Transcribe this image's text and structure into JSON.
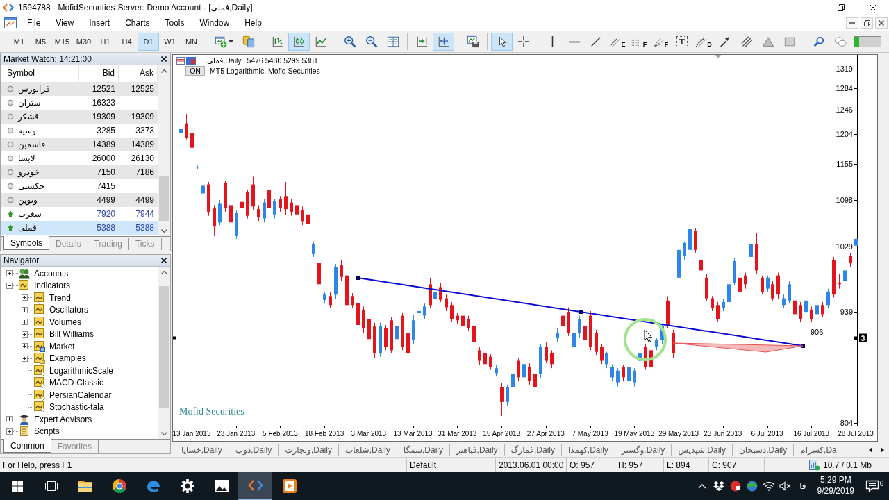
{
  "window": {
    "title": "1594788 - MofidSecurities-Server: Demo Account - [فملی,Daily]"
  },
  "menu": [
    "File",
    "View",
    "Insert",
    "Charts",
    "Tools",
    "Window",
    "Help"
  ],
  "toolbar": {
    "timeframes": [
      {
        "label": "M1",
        "selected": false
      },
      {
        "label": "M5",
        "selected": false
      },
      {
        "label": "M15",
        "selected": false
      },
      {
        "label": "M30",
        "selected": false
      },
      {
        "label": "H1",
        "selected": false
      },
      {
        "label": "H4",
        "selected": false
      },
      {
        "label": "D1",
        "selected": true
      },
      {
        "label": "W1",
        "selected": false
      },
      {
        "label": "MN",
        "selected": false
      }
    ],
    "groups": [
      [
        {
          "kind": "new-chart",
          "selected": false,
          "dropdown": true
        },
        {
          "kind": "profiles",
          "selected": false
        }
      ],
      [
        {
          "kind": "bars",
          "selected": false
        },
        {
          "kind": "candles",
          "selected": true
        },
        {
          "kind": "line",
          "selected": false
        }
      ],
      [
        {
          "kind": "zoom-in",
          "selected": false
        },
        {
          "kind": "zoom-out",
          "selected": false
        },
        {
          "kind": "tile",
          "selected": false
        }
      ],
      [
        {
          "kind": "shift",
          "selected": false
        },
        {
          "kind": "autoscroll",
          "selected": true
        }
      ],
      [
        {
          "kind": "templates",
          "selected": false
        }
      ],
      [
        {
          "kind": "cursor",
          "selected": true
        },
        {
          "kind": "crosshair",
          "selected": false
        }
      ],
      [
        {
          "kind": "vline",
          "selected": false
        },
        {
          "kind": "hline",
          "selected": false
        },
        {
          "kind": "trendline",
          "selected": false
        },
        {
          "kind": "fibo-stairs",
          "selected": false,
          "letter": "E"
        },
        {
          "kind": "fibo-levels",
          "selected": false,
          "letter": "F"
        },
        {
          "kind": "fibo-fan",
          "selected": false,
          "letter": "F"
        },
        {
          "kind": "text",
          "selected": false,
          "letter": "T"
        },
        {
          "kind": "pitchfork",
          "selected": false,
          "letter": "D"
        },
        {
          "kind": "arrow",
          "selected": false
        },
        {
          "kind": "channel",
          "selected": false
        },
        {
          "kind": "triangle",
          "selected": false
        },
        {
          "kind": "rectangle",
          "selected": false
        }
      ],
      [
        {
          "kind": "search",
          "selected": false
        },
        {
          "kind": "chat",
          "selected": false
        }
      ]
    ]
  },
  "market_watch": {
    "title": "Market Watch: 14:21:00",
    "columns": [
      "Symbol",
      "Bid",
      "Ask"
    ],
    "rows": [
      {
        "symbol": "فرابورس",
        "bid": "12521",
        "ask": "12525",
        "kind": "idle",
        "selected": false
      },
      {
        "symbol": "ستران",
        "bid": "16323",
        "kind": "idle",
        "selected": false
      },
      {
        "symbol": "قشکر",
        "bid": "19309",
        "ask": "19309",
        "kind": "idle",
        "selected": false
      },
      {
        "symbol": "وسپه",
        "bid": "3285",
        "ask": "3373",
        "kind": "idle",
        "selected": false
      },
      {
        "symbol": "فاسمین",
        "bid": "14389",
        "ask": "14389",
        "kind": "idle",
        "selected": false
      },
      {
        "symbol": "لابسا",
        "bid": "26000",
        "ask": "26130",
        "kind": "idle",
        "selected": false
      },
      {
        "symbol": "خودرو",
        "bid": "7150",
        "ask": "7186",
        "kind": "idle",
        "selected": false
      },
      {
        "symbol": "حکشتی",
        "bid": "7415",
        "kind": "idle",
        "selected": false
      },
      {
        "symbol": "ونوین",
        "bid": "4499",
        "ask": "4499",
        "kind": "idle",
        "selected": false
      },
      {
        "symbol": "سغرب",
        "bid": "7920",
        "ask": "7944",
        "kind": "up",
        "selected": false
      },
      {
        "symbol": "فملی",
        "bid": "5388",
        "ask": "5388",
        "kind": "up",
        "selected": true
      }
    ],
    "tabs": [
      {
        "label": "Symbols",
        "selected": true
      },
      {
        "label": "Details",
        "selected": false
      },
      {
        "label": "Trading",
        "selected": false
      },
      {
        "label": "Ticks",
        "selected": false
      }
    ]
  },
  "navigator": {
    "title": "Navigator",
    "tree": [
      {
        "label": "Accounts",
        "kind": "accounts",
        "expanded": false
      },
      {
        "label": "Indicators",
        "kind": "folder",
        "expanded": true,
        "children": [
          {
            "label": "Trend",
            "kind": "folder",
            "expanded": false
          },
          {
            "label": "Oscillators",
            "kind": "folder",
            "expanded": false
          },
          {
            "label": "Volumes",
            "kind": "folder",
            "expanded": false
          },
          {
            "label": "Bill Williams",
            "kind": "folder",
            "expanded": false
          },
          {
            "label": "Market",
            "kind": "market",
            "expanded": false
          },
          {
            "label": "Examples",
            "kind": "examples",
            "expanded": false
          },
          {
            "label": "LogarithmicScale",
            "kind": "indicator"
          },
          {
            "label": "MACD-Classic",
            "kind": "indicator"
          },
          {
            "label": "PersianCalendar",
            "kind": "indicator"
          },
          {
            "label": "Stochastic-tala",
            "kind": "indicator"
          }
        ]
      },
      {
        "label": "Expert Advisors",
        "kind": "experts",
        "expanded": false
      },
      {
        "label": "Scripts",
        "kind": "scripts",
        "expanded": false
      }
    ],
    "tabs": [
      {
        "label": "Common",
        "selected": true
      },
      {
        "label": "Favorites",
        "selected": false
      }
    ]
  },
  "chart": {
    "symbol_label": "فملی,Daily",
    "ohlc_text": "5476 5480 5299 5381",
    "indicator_button": "ON",
    "indicator_label": "MT5 Logarithmic, Mofid Securities",
    "caption": "Mofid Securities",
    "price_tag": "3",
    "chart_data": [
      {
        "type": "candlestick",
        "log": true,
        "ylim": [
          801,
          1342
        ],
        "yticks": [
          804,
          939,
          1029,
          1098,
          1155,
          1204,
          1246,
          1284,
          1319
        ],
        "categories": [
          null,
          null,
          "13 Jan 2013",
          null,
          null,
          null,
          null,
          null,
          null,
          null,
          "23 Jan 2013",
          null,
          null,
          null,
          null,
          null,
          null,
          null,
          "5 Feb 2013",
          null,
          null,
          null,
          null,
          null,
          null,
          null,
          "18 Feb 2013",
          null,
          null,
          null,
          null,
          null,
          null,
          null,
          "3 Mar 2013",
          null,
          null,
          null,
          null,
          null,
          null,
          null,
          "13 Mar 2013",
          null,
          null,
          null,
          null,
          null,
          null,
          null,
          "31 Mar 2013",
          null,
          null,
          null,
          null,
          null,
          null,
          null,
          "15 Apr 2013",
          null,
          null,
          null,
          null,
          null,
          null,
          null,
          "27 Apr 2013",
          null,
          null,
          null,
          null,
          null,
          null,
          null,
          "7 May 2013",
          null,
          null,
          null,
          null,
          null,
          null,
          null,
          "19 May 2013",
          null,
          null,
          null,
          null,
          null,
          null,
          null,
          "29 May 2013",
          null,
          null,
          null,
          null,
          null,
          null,
          null,
          "23 Jun 2013",
          null,
          null,
          null,
          null,
          null,
          null,
          null,
          "6 Jul 2013",
          null,
          null,
          null,
          null,
          null,
          null,
          null,
          "16 Jul 2013",
          null,
          null,
          null,
          null,
          null,
          null,
          null,
          "28 Jul 2013"
        ],
        "ohlc": [
          [
            1206,
            1240,
            1200,
            1212
          ],
          [
            1222,
            1238,
            1195,
            1197
          ],
          [
            1205,
            1211,
            1170,
            1181
          ],
          [
            1149,
            1152,
            1146,
            1150
          ],
          [
            1108,
            1124,
            1104,
            1120
          ],
          [
            1122,
            1126,
            1074,
            1080
          ],
          [
            1085,
            1090,
            1044,
            1058
          ],
          [
            1064,
            1098,
            1060,
            1092
          ],
          [
            1125,
            1128,
            1080,
            1085
          ],
          [
            1090,
            1095,
            1060,
            1064
          ],
          [
            1044,
            1082,
            1040,
            1078
          ],
          [
            1095,
            1100,
            1080,
            1086
          ],
          [
            1110,
            1114,
            1070,
            1074
          ],
          [
            1122,
            1134,
            1082,
            1088
          ],
          [
            1084,
            1090,
            1066,
            1072
          ],
          [
            1070,
            1100,
            1064,
            1094
          ],
          [
            1114,
            1130,
            1080,
            1086
          ],
          [
            1076,
            1100,
            1070,
            1096
          ],
          [
            1100,
            1104,
            1080,
            1086
          ],
          [
            1104,
            1126,
            1076,
            1084
          ],
          [
            1094,
            1100,
            1074,
            1080
          ],
          [
            1090,
            1096,
            1070,
            1076
          ],
          [
            1082,
            1088,
            1060,
            1066
          ],
          [
            1076,
            1082,
            1056,
            1062
          ],
          [
            1018,
            1036,
            1014,
            1032
          ],
          [
            1006,
            1012,
            970,
            976
          ],
          [
            955,
            966,
            950,
            962
          ],
          [
            960,
            965,
            944,
            948
          ],
          [
            962,
            1004,
            956,
            1000
          ],
          [
            1002,
            1010,
            980,
            986
          ],
          [
            988,
            992,
            944,
            948
          ],
          [
            960,
            964,
            944,
            948
          ],
          [
            951,
            955,
            918,
            922
          ],
          [
            942,
            946,
            912,
            918
          ],
          [
            930,
            936,
            900,
            904
          ],
          [
            920,
            925,
            880,
            886
          ],
          [
            886,
            925,
            882,
            921
          ],
          [
            918,
            922,
            890,
            894
          ],
          [
            928,
            932,
            886,
            890
          ],
          [
            904,
            926,
            900,
            921
          ],
          [
            934,
            938,
            890,
            894
          ],
          [
            912,
            916,
            882,
            886
          ],
          [
            903,
            935,
            898,
            928
          ],
          [
            938,
            942,
            936,
            940
          ],
          [
            934,
            950,
            930,
            946
          ],
          [
            976,
            985,
            944,
            948
          ],
          [
            956,
            970,
            950,
            966
          ],
          [
            972,
            978,
            952,
            955
          ],
          [
            957,
            962,
            940,
            945
          ],
          [
            948,
            952,
            926,
            930
          ],
          [
            934,
            938,
            924,
            928
          ],
          [
            934,
            937,
            918,
            921
          ],
          [
            930,
            934,
            914,
            918
          ],
          [
            921,
            925,
            896,
            900
          ],
          [
            890,
            894,
            872,
            877
          ],
          [
            886,
            888,
            870,
            873
          ],
          [
            882,
            885,
            866,
            869
          ],
          [
            862,
            872,
            858,
            868
          ],
          [
            845,
            850,
            812,
            828
          ],
          [
            828,
            848,
            824,
            845
          ],
          [
            845,
            864,
            840,
            861
          ],
          [
            877,
            880,
            852,
            857
          ],
          [
            857,
            876,
            852,
            873
          ],
          [
            869,
            874,
            848,
            853
          ],
          [
            861,
            864,
            838,
            845
          ],
          [
            861,
            898,
            856,
            894
          ],
          [
            894,
            900,
            874,
            877
          ],
          [
            886,
            890,
            868,
            873
          ],
          [
            905,
            918,
            900,
            912
          ],
          [
            934,
            940,
            918,
            921
          ],
          [
            939,
            945,
            908,
            912
          ],
          [
            894,
            918,
            890,
            912
          ],
          [
            912,
            934,
            906,
            930
          ],
          [
            921,
            926,
            900,
            903
          ],
          [
            934,
            940,
            890,
            894
          ],
          [
            912,
            916,
            884,
            888
          ],
          [
            894,
            898,
            873,
            877
          ],
          [
            873,
            888,
            868,
            886
          ],
          [
            857,
            872,
            852,
            869
          ],
          [
            851,
            868,
            846,
            865
          ],
          [
            869,
            872,
            852,
            857
          ],
          [
            853,
            872,
            848,
            869
          ],
          [
            851,
            868,
            846,
            865
          ],
          [
            877,
            890,
            872,
            886
          ],
          [
            894,
            898,
            866,
            869
          ],
          [
            890,
            893,
            866,
            869
          ],
          [
            894,
            905,
            890,
            903
          ],
          [
            903,
            924,
            898,
            921
          ],
          [
            954,
            960,
            918,
            921
          ],
          [
            912,
            916,
            880,
            886
          ],
          [
            985,
            1028,
            980,
            1024
          ],
          [
            1015,
            1036,
            1010,
            1034
          ],
          [
            1024,
            1060,
            1020,
            1054
          ],
          [
            1052,
            1056,
            1020,
            1024
          ],
          [
            1010,
            1014,
            990,
            995
          ],
          [
            985,
            990,
            954,
            957
          ],
          [
            957,
            960,
            940,
            944
          ],
          [
            948,
            952,
            926,
            930
          ],
          [
            944,
            956,
            940,
            952
          ],
          [
            952,
            980,
            948,
            976
          ],
          [
            978,
            1012,
            974,
            1008
          ],
          [
            985,
            990,
            960,
            966
          ],
          [
            988,
            992,
            970,
            976
          ],
          [
            1014,
            1036,
            1010,
            1032
          ],
          [
            1032,
            1048,
            990,
            995
          ],
          [
            985,
            988,
            962,
            966
          ],
          [
            970,
            988,
            966,
            985
          ],
          [
            976,
            980,
            954,
            957
          ],
          [
            988,
            992,
            956,
            962
          ],
          [
            948,
            962,
            944,
            957
          ],
          [
            954,
            980,
            950,
            976
          ],
          [
            954,
            958,
            930,
            936
          ],
          [
            948,
            952,
            926,
            930
          ],
          [
            939,
            956,
            934,
            954
          ],
          [
            942,
            946,
            926,
            930
          ],
          [
            936,
            950,
            930,
            948
          ],
          [
            948,
            952,
            932,
            936
          ],
          [
            948,
            970,
            944,
            966
          ],
          [
            1010,
            1014,
            958,
            962
          ],
          [
            978,
            990,
            970,
            976
          ],
          [
            980,
            1000,
            970,
            995
          ],
          [
            1015,
            1020,
            1000,
            1005
          ],
          [
            1030,
            1044,
            1020,
            1040
          ]
        ],
        "ref_lines": [
          {
            "axis": "y",
            "value": 906,
            "label": "906",
            "color": "#000000",
            "line_style": "dashed"
          }
        ]
      }
    ]
  },
  "chart_tabs": [
    {
      "label": "خساپا,Daily",
      "selected": false
    },
    {
      "label": "ذوب,Daily",
      "selected": false
    },
    {
      "label": "وتجارت,Daily",
      "selected": false
    },
    {
      "label": "شلعاب,Daily",
      "selected": false
    },
    {
      "label": "سمگا,Daily",
      "selected": false
    },
    {
      "label": "فباهنر,Daily",
      "selected": false
    },
    {
      "label": "غمارگ,Daily",
      "selected": false
    },
    {
      "label": "کهمدا,Daily",
      "selected": false
    },
    {
      "label": "وگستر,Daily",
      "selected": false
    },
    {
      "label": "شپدیس,Daily",
      "selected": false
    },
    {
      "label": "دسبحان,Daily",
      "selected": false
    },
    {
      "label": "کسرام,Da",
      "selected": false
    }
  ],
  "status_bar": {
    "help": "For Help, press F1",
    "profile": "Default",
    "datetime": "2013.06.01 00:00",
    "open": "O: 957",
    "high": "H: 957",
    "low": "L: 894",
    "close": "C: 907",
    "traffic": "10.7 / 0.1 Mb"
  },
  "taskbar": {
    "apps": [
      {
        "kind": "start",
        "selected": false
      },
      {
        "kind": "task-view",
        "selected": false
      },
      {
        "kind": "folder",
        "selected": false
      },
      {
        "kind": "ring-browser",
        "selected": false
      },
      {
        "kind": "swirl-browser",
        "selected": false
      },
      {
        "kind": "settings",
        "selected": false
      },
      {
        "kind": "photos",
        "selected": false
      },
      {
        "kind": "brackets",
        "selected": true
      },
      {
        "kind": "player",
        "selected": false
      }
    ],
    "language": "فا",
    "time": "5:29 PM",
    "date": "9/29/2019",
    "notifications": "6"
  }
}
